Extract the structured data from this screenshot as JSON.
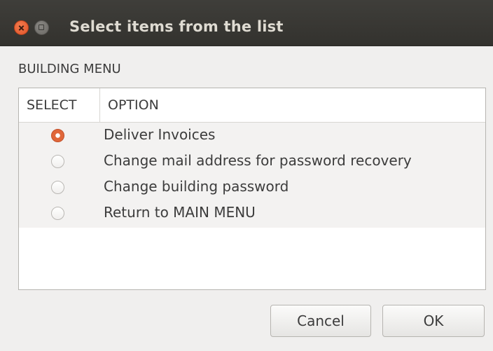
{
  "window": {
    "title": "Select items from the list"
  },
  "menu": {
    "label": "BUILDING MENU"
  },
  "list": {
    "columns": [
      "SELECT",
      "OPTION"
    ],
    "rows": [
      {
        "label": "Deliver Invoices",
        "selected": true
      },
      {
        "label": "Change mail address for password recovery",
        "selected": false
      },
      {
        "label": "Change building password",
        "selected": false
      },
      {
        "label": "Return to MAIN MENU",
        "selected": false
      }
    ]
  },
  "buttons": {
    "cancel_label": "Cancel",
    "ok_label": "OK"
  },
  "colors": {
    "accent": "#e0673a",
    "titlebar": "#3c3b37"
  },
  "icons": {
    "close": "close-icon",
    "minimize": "minimize-icon"
  }
}
